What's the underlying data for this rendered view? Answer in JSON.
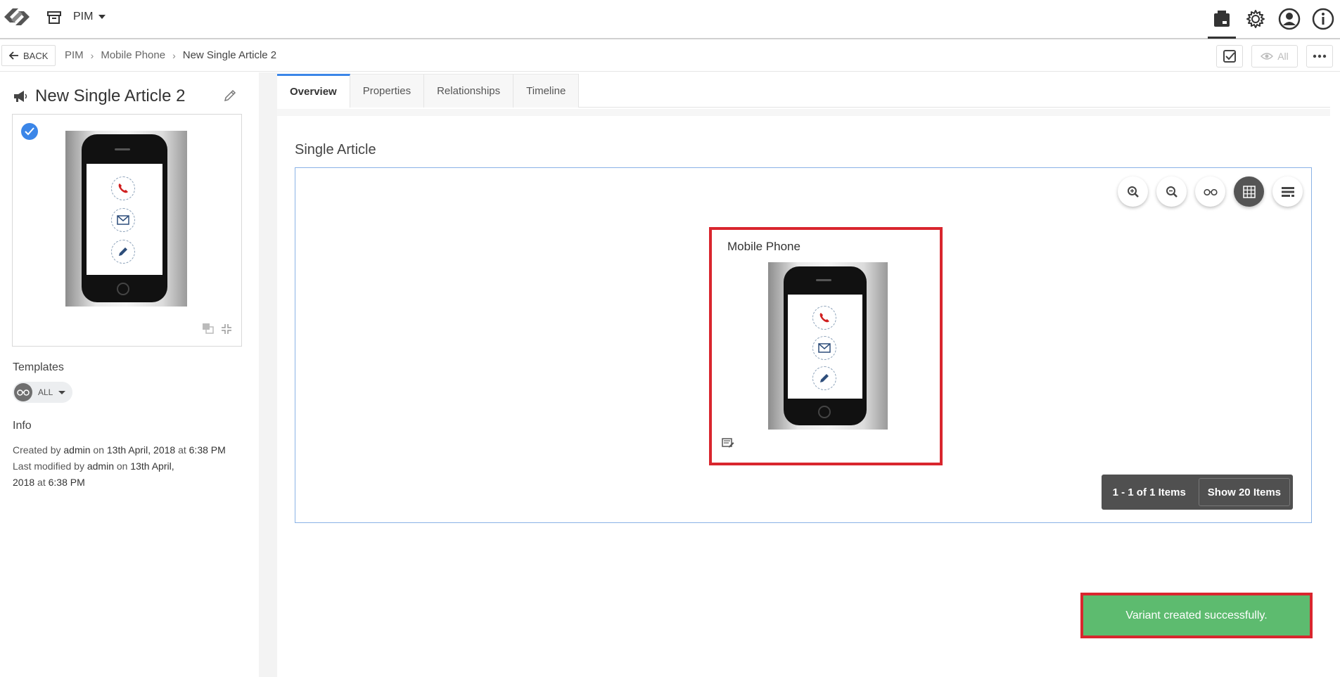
{
  "header": {
    "module": "PIM"
  },
  "breadcrumb": {
    "back_label": "BACK",
    "items": [
      "PIM",
      "Mobile Phone",
      "New Single Article 2"
    ],
    "separator": "›",
    "view_label": "All"
  },
  "entity": {
    "title": "New Single Article 2"
  },
  "templates": {
    "label": "Templates",
    "value": "ALL"
  },
  "info": {
    "label": "Info",
    "created_prefix": "Created by",
    "created_user": "admin",
    "created_on": "on",
    "created_date": "13th April, 2018",
    "created_at": "at",
    "created_time": "6:38 PM",
    "modified_prefix": "Last modified by",
    "modified_user": "admin",
    "modified_on": "on",
    "modified_date_a": "13th April,",
    "modified_date_b": "2018",
    "modified_at": "at",
    "modified_time": "6:38 PM"
  },
  "tabs": [
    "Overview",
    "Properties",
    "Relationships",
    "Timeline"
  ],
  "overview": {
    "section_title": "Single Article",
    "tile_title": "Mobile Phone",
    "pager_count": "1 - 1 of 1 Items",
    "pager_show": "Show 20 Items"
  },
  "toast": {
    "message": "Variant created successfully."
  },
  "colors": {
    "accent": "#3b86e8",
    "highlight": "#d9262e",
    "success": "#5dbb6f"
  }
}
